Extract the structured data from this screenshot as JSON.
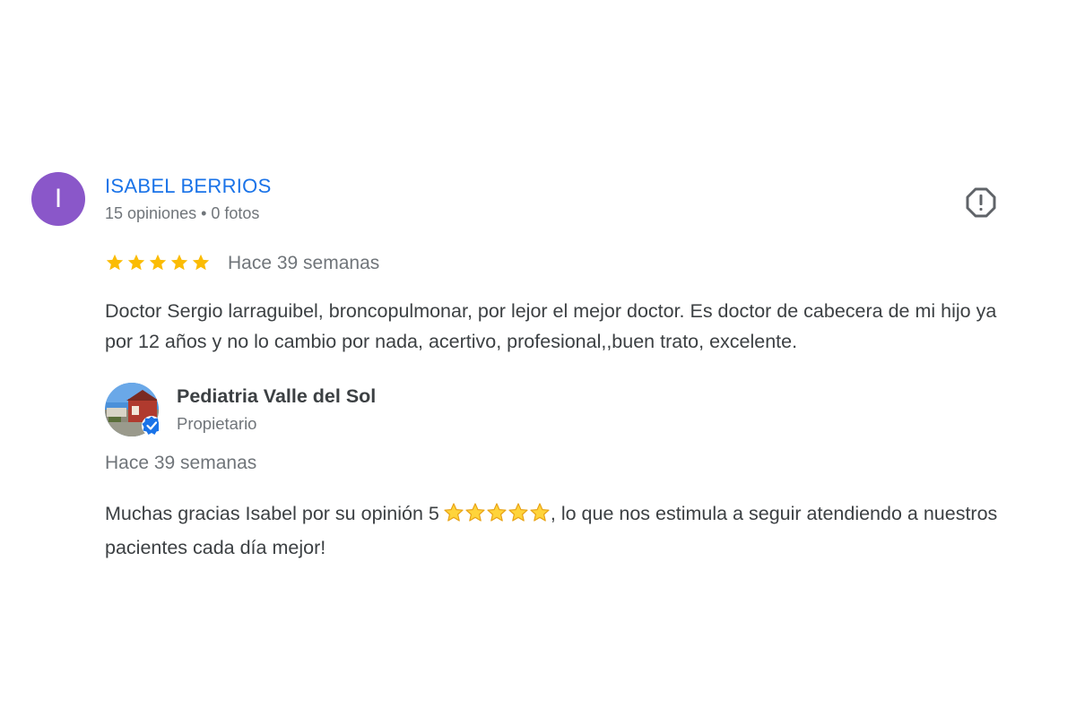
{
  "review": {
    "author": {
      "initial": "I",
      "name": "ISABEL BERRIOS",
      "meta": "15 opiniones • 0 fotos",
      "avatar_color": "#8a57c9",
      "name_color": "#1a73e8"
    },
    "report_icon": "report-flag-icon",
    "rating": 5,
    "rating_max": 5,
    "star_color": "#fbbc04",
    "date": "Hace 39 semanas",
    "text": "Doctor Sergio larraguibel, broncopulmonar, por lejor el mejor doctor. Es doctor de cabecera de mi hijo ya por 12 años y no lo cambio por nada, acertivo, profesional,,buen trato, excelente."
  },
  "reply": {
    "owner_name": "Pediatria Valle del Sol",
    "owner_role": "Propietario",
    "verified_icon": "verified-check-icon",
    "date": "Hace 39 semanas",
    "text_before": "Muchas gracias Isabel por su opinión 5",
    "emoji_stars": 5,
    "text_after": ", lo que nos estimula a seguir atendiendo a nuestros pacientes cada día mejor!"
  }
}
